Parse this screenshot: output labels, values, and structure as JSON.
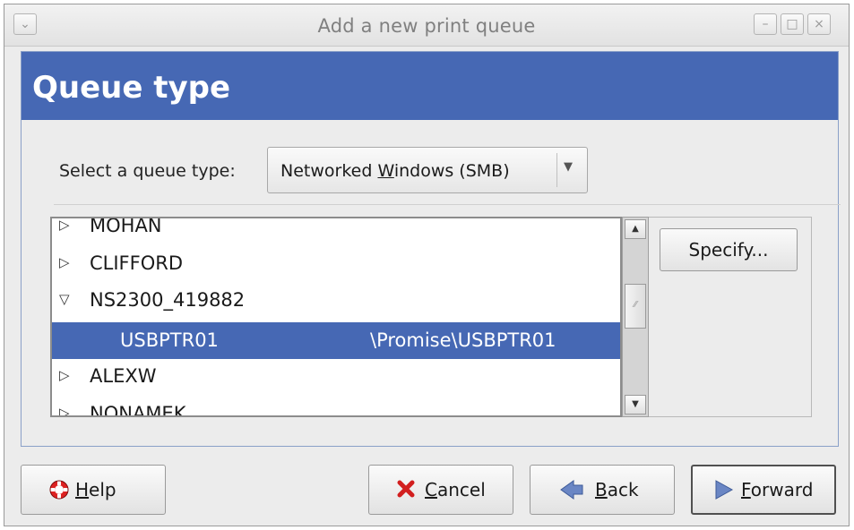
{
  "window": {
    "title": "Add a new print queue"
  },
  "header": {
    "title": "Queue type"
  },
  "queue_type": {
    "label": "Select a queue type:",
    "selected_value": "Networked Windows (SMB)"
  },
  "tree": {
    "rows": [
      {
        "label": "MOHAN",
        "expanded": false
      },
      {
        "label": "CLIFFORD",
        "expanded": false
      },
      {
        "label": "NS2300_419882",
        "expanded": true
      },
      {
        "label": "USBPTR01",
        "path": "\\Promise\\USBPTR01",
        "selected": true
      },
      {
        "label": "ALEXW",
        "expanded": false
      },
      {
        "label": "NONAMEK",
        "expanded": false
      }
    ],
    "colors": {
      "selection": "#4668b4"
    }
  },
  "buttons": {
    "specify": "Specify...",
    "help": "Help",
    "cancel": "Cancel",
    "back": "Back",
    "forward": "Forward"
  },
  "icons": {
    "help": "lifebuoy-icon",
    "cancel": "x-icon",
    "back": "arrow-left-icon",
    "forward": "arrow-right-icon"
  },
  "colors": {
    "header_band": "#4668b4"
  }
}
